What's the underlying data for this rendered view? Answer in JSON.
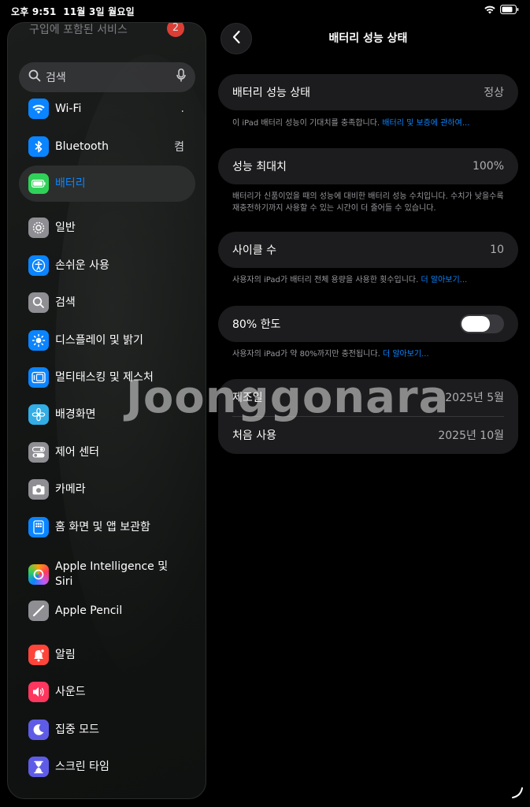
{
  "status_bar": {
    "time": "오후 9:51",
    "date": "11월 3일 월요일"
  },
  "sidebar": {
    "partial_item": "구입에 포함된 서비스",
    "partial_badge": "2",
    "search": {
      "placeholder": "검색"
    },
    "items": [
      {
        "label": "Wi-Fi",
        "value": "",
        "icon": "wifi-icon",
        "color": "#0a84ff"
      },
      {
        "label": "Bluetooth",
        "value": "켬",
        "icon": "bluetooth-icon",
        "color": "#0a84ff"
      },
      {
        "label": "배터리",
        "value": "",
        "icon": "battery-icon",
        "color": "#30d158",
        "selected": true
      },
      {
        "label": "일반",
        "icon": "gear-icon",
        "color": "#8e8e93"
      },
      {
        "label": "손쉬운 사용",
        "icon": "accessibility-icon",
        "color": "#0a84ff"
      },
      {
        "label": "검색",
        "icon": "search-icon",
        "color": "#8e8e93"
      },
      {
        "label": "디스플레이 및 밝기",
        "icon": "brightness-icon",
        "color": "#0a84ff"
      },
      {
        "label": "멀티태스킹 및 제스처",
        "icon": "multitasking-icon",
        "color": "#0a84ff"
      },
      {
        "label": "배경화면",
        "icon": "flower-icon",
        "color": "#32ade6"
      },
      {
        "label": "제어 센터",
        "icon": "toggles-icon",
        "color": "#8e8e93"
      },
      {
        "label": "카메라",
        "icon": "camera-icon",
        "color": "#8e8e93"
      },
      {
        "label": "홈 화면 및 앱 보관함",
        "icon": "home-screen-icon",
        "color": "#0a84ff"
      },
      {
        "label": "Apple Intelligence 및 Siri",
        "icon": "apple-intelligence-icon",
        "color": "#bf5af2"
      },
      {
        "label": "Apple Pencil",
        "icon": "pencil-icon",
        "color": "#8e8e93"
      },
      {
        "label": "알림",
        "icon": "bell-icon",
        "color": "#ff453a"
      },
      {
        "label": "사운드",
        "icon": "speaker-icon",
        "color": "#ff375f"
      },
      {
        "label": "집중 모드",
        "icon": "moon-icon",
        "color": "#5e5ce6"
      },
      {
        "label": "스크린 타임",
        "icon": "hourglass-icon",
        "color": "#5e5ce6"
      }
    ]
  },
  "detail": {
    "title": "배터리 성능 상태",
    "health": {
      "label": "배터리 성능 상태",
      "value": "정상",
      "footnote": "이 iPad 배터리 성능이 기대치를 충족합니다.",
      "link": "배터리 및 보증에 관하여..."
    },
    "max_capacity": {
      "label": "성능 최대치",
      "value": "100%",
      "footnote": "배터리가 신품이었을 때의 성능에 대비한 배터리 성능 수치입니다. 수치가 낮을수록 재충전하기까지 사용할 수 있는 시간이 더 줄어들 수 있습니다."
    },
    "cycle_count": {
      "label": "사이클 수",
      "value": "10",
      "footnote": "사용자의 iPad가 배터리 전체 용량을 사용한 횟수입니다.",
      "link": "더 알아보기..."
    },
    "limit_80": {
      "label": "80% 한도",
      "enabled": false,
      "footnote": "사용자의 iPad가 약 80%까지만 충전됩니다.",
      "link": "더 알아보기..."
    },
    "manufacture": {
      "label": "제조일",
      "value": "2025년 5월"
    },
    "first_use": {
      "label": "처음 사용",
      "value": "2025년 10월"
    }
  },
  "watermark": "Joonggonara"
}
